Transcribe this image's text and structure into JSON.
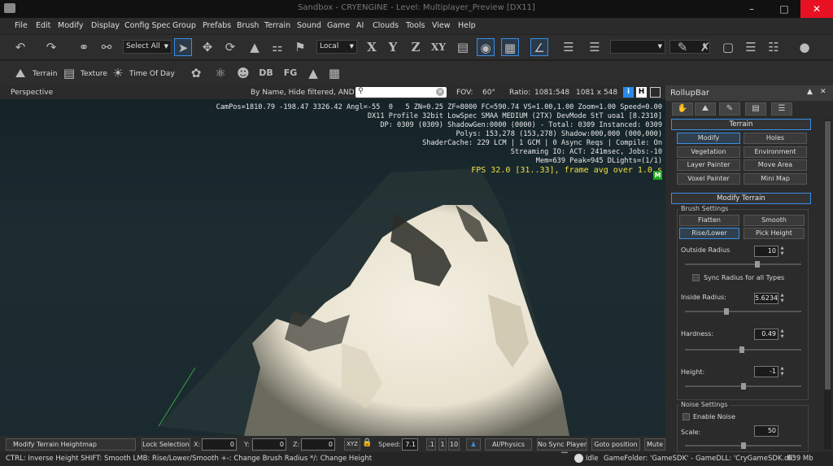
{
  "window": {
    "title": "Sandbox - CRYENGINE - Level: Multiplayer_Preview [DX11]"
  },
  "menu": [
    "File",
    "Edit",
    "Modify",
    "Display",
    "Config Spec",
    "Group",
    "Prefabs",
    "Brush",
    "Terrain",
    "Sound",
    "Game",
    "AI",
    "Clouds",
    "Tools",
    "View",
    "Help"
  ],
  "toolbar1": {
    "select_all": "Select All",
    "coord_system": "Local"
  },
  "toolbar2": {
    "terrain": "Terrain",
    "texture": "Texture",
    "time_of_day": "Time Of Day"
  },
  "viewport_header": {
    "view_name": "Perspective",
    "filter_label": "By Name, Hide filtered, AND",
    "search_value": "",
    "fov_label": "FOV:",
    "fov_value": "60°",
    "ratio_label": "Ratio:",
    "ratio_value": "1081:548",
    "resolution": "1081 x 548",
    "btn_i": "i",
    "btn_h": "H"
  },
  "overlay": {
    "campos": "CamPos=1810.79 -198.47 3326.42 Angl=-55  0   5 ZN=0.25 ZF=8000 FC=590.74 VS=1.00,1.00 Zoom=1.00 Speed=0.00",
    "profile": "DX11 Profile 32bit LowSpec SMAA MEDIUM (2TX) DevMode StT uoa1 [8.2310]",
    "dp": "DP: 0309 (0309) ShadowGen:0000 (0000) - Total: 0309 Instanced: 0309",
    "polys": "Polys: 153,278 (153,278) Shadow:000,000 (000,000)",
    "shadercache": "ShaderCache: 229 LCM | 1 GCM | 0 Async Reqs | Compile: On",
    "streaming": "Streaming IO: ACT: 241msec, Jobs:-10",
    "mem": "Mem=639 Peak=945 DLights=(1/1)",
    "fps": "FPS 32.0 [31..33], frame avg over 1.0 s",
    "m_badge": "M"
  },
  "bottom": {
    "task": "Modify Terrain Heightmap",
    "lock_selection": "Lock Selection",
    "x_label": "X:",
    "x_value": "0",
    "y_label": "Y:",
    "y_value": "0",
    "z_label": "Z:",
    "z_value": "0",
    "xyz": "XYZ",
    "speed_label": "Speed:",
    "speed_value": "7.1",
    "speed_1": ".1",
    "speed_2": "1",
    "speed_3": "10",
    "ai_physics": "AI/Physics",
    "no_sync": "No Sync Player",
    "goto": "Goto position",
    "mute": "Mute"
  },
  "status": {
    "hint": "CTRL: Inverse Height  SHIFT: Smooth  LMB: Rise/Lower/Smooth  +-: Change Brush Radius  */: Change Height",
    "state": "Idle",
    "game_info": "GameFolder: 'GameSDK' - GameDLL: 'CryGameSDK.dll'",
    "memory": "639 Mb"
  },
  "rollup": {
    "title": "RollupBar",
    "terrain_section": "Terrain",
    "buttons": [
      "Modify",
      "Holes",
      "Vegetation",
      "Environment",
      "Layer Painter",
      "Move Area",
      "Voxel Painter",
      "Mini Map"
    ],
    "modify_section": "Modify Terrain",
    "brush_settings": "Brush Settings",
    "brush_buttons": [
      "Flatten",
      "Smooth",
      "Rise/Lower",
      "Pick Height"
    ],
    "outside_radius_label": "Outside Radius",
    "outside_radius_value": "10",
    "outside_radius_level": 0.62,
    "sync_radius": "Sync Radius for all Types",
    "inside_radius_label": "Inside Radius:",
    "inside_radius_value": "5.6234",
    "inside_radius_level": 0.36,
    "hardness_label": "Hardness:",
    "hardness_value": "0.49",
    "hardness_level": 0.49,
    "height_label": "Height:",
    "height_value": "-1",
    "height_level": 0.5,
    "noise_settings": "Noise Settings",
    "enable_noise": "Enable Noise",
    "scale_label": "Scale:",
    "scale_value": "50",
    "scale_level": 0.5
  },
  "colors": {
    "accent": "#3a8ee6",
    "close": "#e81123",
    "fps": "#f0e040",
    "badge": "#1faa1f"
  }
}
